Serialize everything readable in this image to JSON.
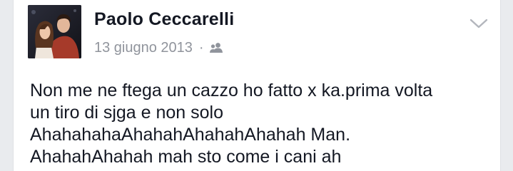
{
  "post": {
    "author_name": "Paolo Ceccarelli",
    "date": "13 giugno 2013",
    "separator": "·",
    "audience_icon": "friends-icon",
    "options_icon": "chevron-down-icon",
    "text_lines": [
      "Non me ne ftega un cazzo ho fatto x ka.prima volta",
      "un tiro di sjga e non solo",
      "AhahahahaAhahahAhahahAhahah Man.",
      "AhahahAhahah mah sto come i cani ah"
    ]
  },
  "colors": {
    "background": "#e9ebee",
    "card": "#ffffff",
    "name": "#141823",
    "meta": "#90949c"
  }
}
